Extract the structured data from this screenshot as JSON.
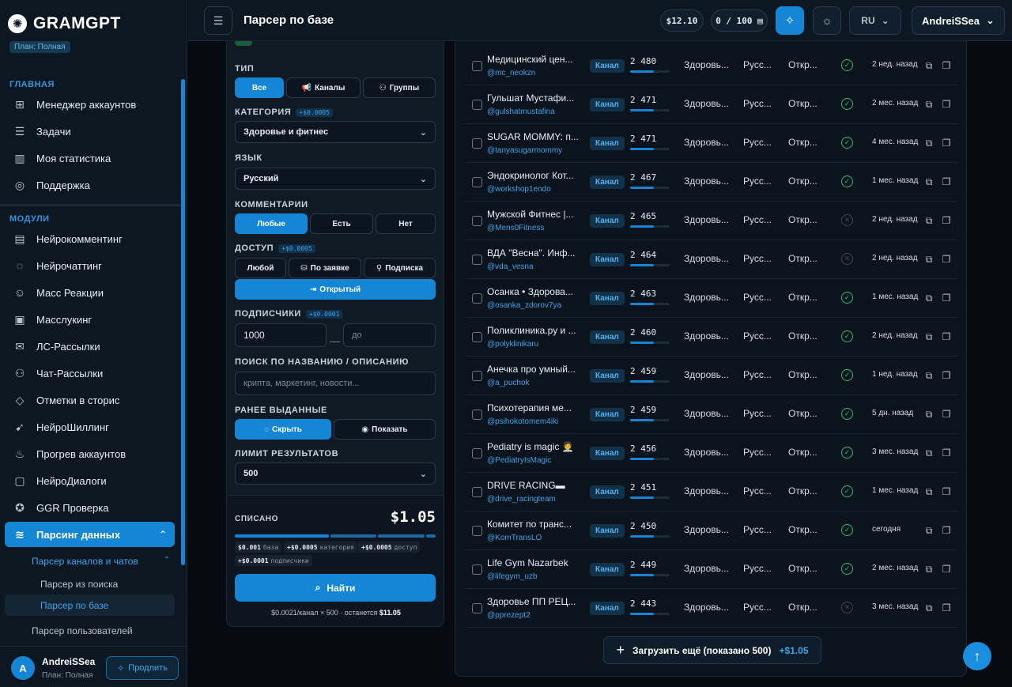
{
  "brand": {
    "name": "GRAMGPT",
    "plan_badge": "План: Полная",
    "logo_glyph": "✺"
  },
  "sidebar": {
    "main_title": "ГЛАВНАЯ",
    "main_items": [
      {
        "label": "Менеджер аккаунтов",
        "icon": "⊞"
      },
      {
        "label": "Задачи",
        "icon": "☰"
      },
      {
        "label": "Моя статистика",
        "icon": "▥"
      },
      {
        "label": "Поддержка",
        "icon": "◎"
      }
    ],
    "modules_title": "МОДУЛИ",
    "module_items": [
      {
        "label": "Нейрокомментинг",
        "icon": "▤"
      },
      {
        "label": "Нейрочаттинг",
        "icon": "◌"
      },
      {
        "label": "Масс Реакции",
        "icon": "☺"
      },
      {
        "label": "Масслукинг",
        "icon": "▣"
      },
      {
        "label": "ЛС-Рассылки",
        "icon": "✉"
      },
      {
        "label": "Чат-Рассылки",
        "icon": "⚇"
      },
      {
        "label": "Отметки в сторис",
        "icon": "◇"
      },
      {
        "label": "НейроШиллинг",
        "icon": "➹"
      },
      {
        "label": "Прогрев аккаунтов",
        "icon": "♨"
      },
      {
        "label": "НейроДиалоги",
        "icon": "▢"
      },
      {
        "label": "GGR Проверка",
        "icon": "✪"
      },
      {
        "label": "Парсинг данных",
        "icon": "≋"
      }
    ],
    "sub_parent": "Парсер каналов и чатов",
    "sub_items": [
      "Парсер из поиска",
      "Парсер по базе"
    ],
    "users_parser": "Парсер пользователей",
    "user": {
      "initial": "A",
      "name": "AndreiSSea",
      "plan": "План: Полная",
      "extend_label": "Продлить"
    }
  },
  "header": {
    "title": "Парсер по базе",
    "balance": "$12.10",
    "quota": "0 / 100",
    "lang": "RU",
    "username": "AndreiSSea"
  },
  "filters": {
    "type_label": "ТИП",
    "type_options": [
      "Все",
      "Каналы",
      "Группы"
    ],
    "category_label": "КАТЕГОРИЯ",
    "category_price": "+$0.0005",
    "category_value": "Здоровье и фитнес",
    "language_label": "ЯЗЫК",
    "language_value": "Русский",
    "comments_label": "КОММЕНТАРИИ",
    "comments_options": [
      "Любые",
      "Есть",
      "Нет"
    ],
    "access_label": "ДОСТУП",
    "access_price": "+$0.0005",
    "access_options": [
      "Любой",
      "По заявке",
      "Подписка",
      "Открытый"
    ],
    "subs_label": "ПОДПИСЧИКИ",
    "subs_price": "+$0.0001",
    "subs_from": "1000",
    "subs_to_placeholder": "до",
    "search_label": "ПОИСК ПО НАЗВАНИЮ / ОПИСАНИЮ",
    "search_placeholder": "крипта, маркетинг, новости...",
    "issued_label": "РАНЕЕ ВЫДАННЫЕ",
    "issued_options": [
      "Скрыть",
      "Показать"
    ],
    "limit_label": "ЛИМИТ РЕЗУЛЬТАТОВ",
    "limit_value": "500"
  },
  "cost": {
    "label": "СПИСАНО",
    "total": "$1.05",
    "chips": [
      {
        "value": "$0.001",
        "name": "база"
      },
      {
        "value": "+$0.0005",
        "name": "категория"
      },
      {
        "value": "+$0.0005",
        "name": "доступ"
      },
      {
        "value": "+$0.0001",
        "name": "подписчики"
      }
    ],
    "find_label": "Найти",
    "foot_text": "$0.0021/канал × 500 · останется",
    "foot_remaining": "$11.05"
  },
  "results": {
    "rows": [
      {
        "name": "Медицинский цен...",
        "handle": "@mc_neokzn",
        "type": "Канал",
        "subs": "2 480",
        "fill": 0.6,
        "category": "Здоровь...",
        "lang": "Русс...",
        "access": "Откр...",
        "status": "ok",
        "date": "2 нед. назад"
      },
      {
        "name": "Гульшат Мустафи...",
        "handle": "@gulshatmustafina",
        "type": "Канал",
        "subs": "2 471",
        "fill": 0.6,
        "category": "Здоровь...",
        "lang": "Русс...",
        "access": "Откр...",
        "status": "ok",
        "date": "2 мес. назад"
      },
      {
        "name": "SUGAR MOMMY: п...",
        "handle": "@tanyasugarmommy",
        "type": "Канал",
        "subs": "2 471",
        "fill": 0.6,
        "category": "Здоровь...",
        "lang": "Русс...",
        "access": "Откр...",
        "status": "ok",
        "date": "4 мес. назад"
      },
      {
        "name": "Эндокринолог Кот...",
        "handle": "@workshop1endo",
        "type": "Канал",
        "subs": "2 467",
        "fill": 0.6,
        "category": "Здоровь...",
        "lang": "Русс...",
        "access": "Откр...",
        "status": "ok",
        "date": "1 мес. назад"
      },
      {
        "name": "Мужской Фитнес |...",
        "handle": "@Mens0Fitness",
        "type": "Канал",
        "subs": "2 465",
        "fill": 0.6,
        "category": "Здоровь...",
        "lang": "Русс...",
        "access": "Откр...",
        "status": "no",
        "date": "2 нед. назад"
      },
      {
        "name": "ВДА \"Весна\". Инф...",
        "handle": "@vda_vesna",
        "type": "Канал",
        "subs": "2 464",
        "fill": 0.6,
        "category": "Здоровь...",
        "lang": "Русс...",
        "access": "Откр...",
        "status": "no",
        "date": "2 нед. назад"
      },
      {
        "name": "Осанка • Здорова...",
        "handle": "@osanka_zdorov7ya",
        "type": "Канал",
        "subs": "2 463",
        "fill": 0.6,
        "category": "Здоровь...",
        "lang": "Русс...",
        "access": "Откр...",
        "status": "ok",
        "date": "1 мес. назад"
      },
      {
        "name": "Поликлиника.ру и ...",
        "handle": "@polyklinikaru",
        "type": "Канал",
        "subs": "2 460",
        "fill": 0.6,
        "category": "Здоровь...",
        "lang": "Русс...",
        "access": "Откр...",
        "status": "ok",
        "date": "2 нед. назад"
      },
      {
        "name": "Анечка про умный...",
        "handle": "@a_puchok",
        "type": "Канал",
        "subs": "2 459",
        "fill": 0.6,
        "category": "Здоровь...",
        "lang": "Русс...",
        "access": "Откр...",
        "status": "ok",
        "date": "1 нед. назад"
      },
      {
        "name": "Психотерапия ме...",
        "handle": "@psihokotomem4iki",
        "type": "Канал",
        "subs": "2 459",
        "fill": 0.6,
        "category": "Здоровь...",
        "lang": "Русс...",
        "access": "Откр...",
        "status": "ok",
        "date": "5 дн. назад"
      },
      {
        "name": "Pediatry is magic 🧑‍⚕️",
        "handle": "@PediatryIsMagic",
        "type": "Канал",
        "subs": "2 456",
        "fill": 0.6,
        "category": "Здоровь...",
        "lang": "Русс...",
        "access": "Откр...",
        "status": "ok",
        "date": "3 мес. назад"
      },
      {
        "name": "DRIVE RACING▬",
        "handle": "@drive_racingteam",
        "type": "Канал",
        "subs": "2 451",
        "fill": 0.6,
        "category": "Здоровь...",
        "lang": "Русс...",
        "access": "Откр...",
        "status": "ok",
        "date": "1 мес. назад"
      },
      {
        "name": "Комитет по транс...",
        "handle": "@KomTransLO",
        "type": "Канал",
        "subs": "2 450",
        "fill": 0.6,
        "category": "Здоровь...",
        "lang": "Русс...",
        "access": "Откр...",
        "status": "ok",
        "date": "сегодня"
      },
      {
        "name": "Life Gym Nazarbek",
        "handle": "@lifegym_uzb",
        "type": "Канал",
        "subs": "2 449",
        "fill": 0.6,
        "category": "Здоровь...",
        "lang": "Русс...",
        "access": "Откр...",
        "status": "ok",
        "date": "2 мес. назад"
      },
      {
        "name": "Здоровье ПП РЕЦ...",
        "handle": "@pprezept2",
        "type": "Канал",
        "subs": "2 443",
        "fill": 0.6,
        "category": "Здоровь...",
        "lang": "Русс...",
        "access": "Откр...",
        "status": "no",
        "date": "3 мес. назад"
      }
    ],
    "load_more_label": "Загрузить ещё (показано 500)",
    "load_more_cost": "+$1.05"
  },
  "colors": {
    "accent": "#1586d6",
    "ok": "#22c17a",
    "bg": "#070b11"
  }
}
